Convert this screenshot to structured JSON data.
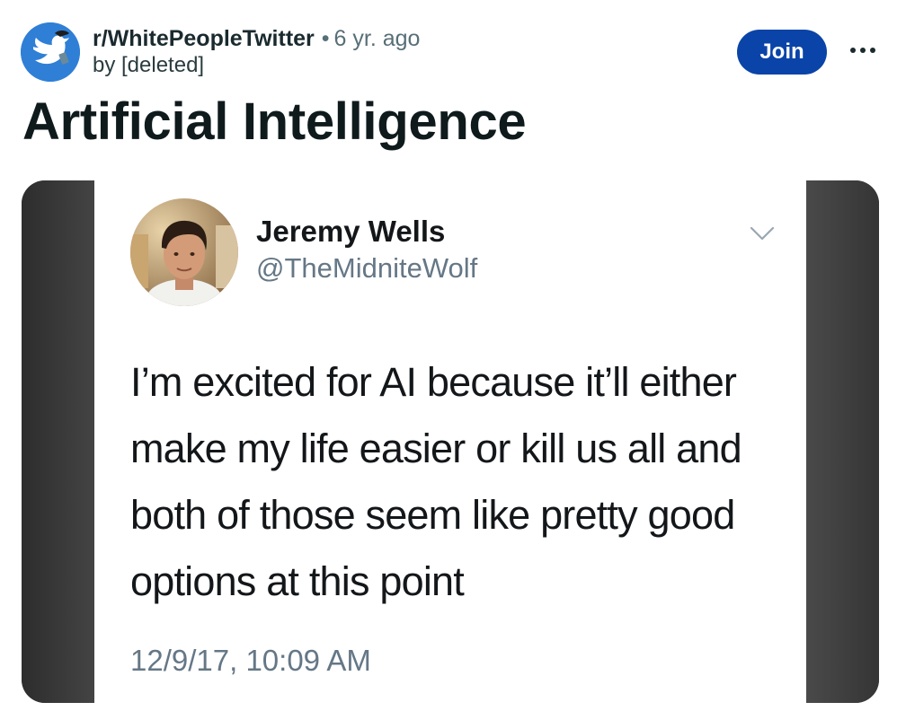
{
  "post": {
    "subreddit": "r/WhitePeopleTwitter",
    "separator": "•",
    "age": "6 yr. ago",
    "author": "by [deleted]",
    "join_label": "Join",
    "title": "Artificial Intelligence"
  },
  "tweet": {
    "name": "Jeremy Wells",
    "handle": "@TheMidniteWolf",
    "text": "I’m excited for AI because it’ll either make my life easier or kill us all and both of those seem like pretty good options at this point",
    "timestamp": "12/9/17, 10:09 AM"
  },
  "icons": {
    "subreddit_avatar": "twitter-bird-icon",
    "more": "more-options-icon",
    "chevron": "chevron-down-icon"
  },
  "colors": {
    "join_button": "#0a44a8",
    "subreddit_avatar_bg": "#2f7fd6",
    "media_background": "#3a3a3a"
  }
}
